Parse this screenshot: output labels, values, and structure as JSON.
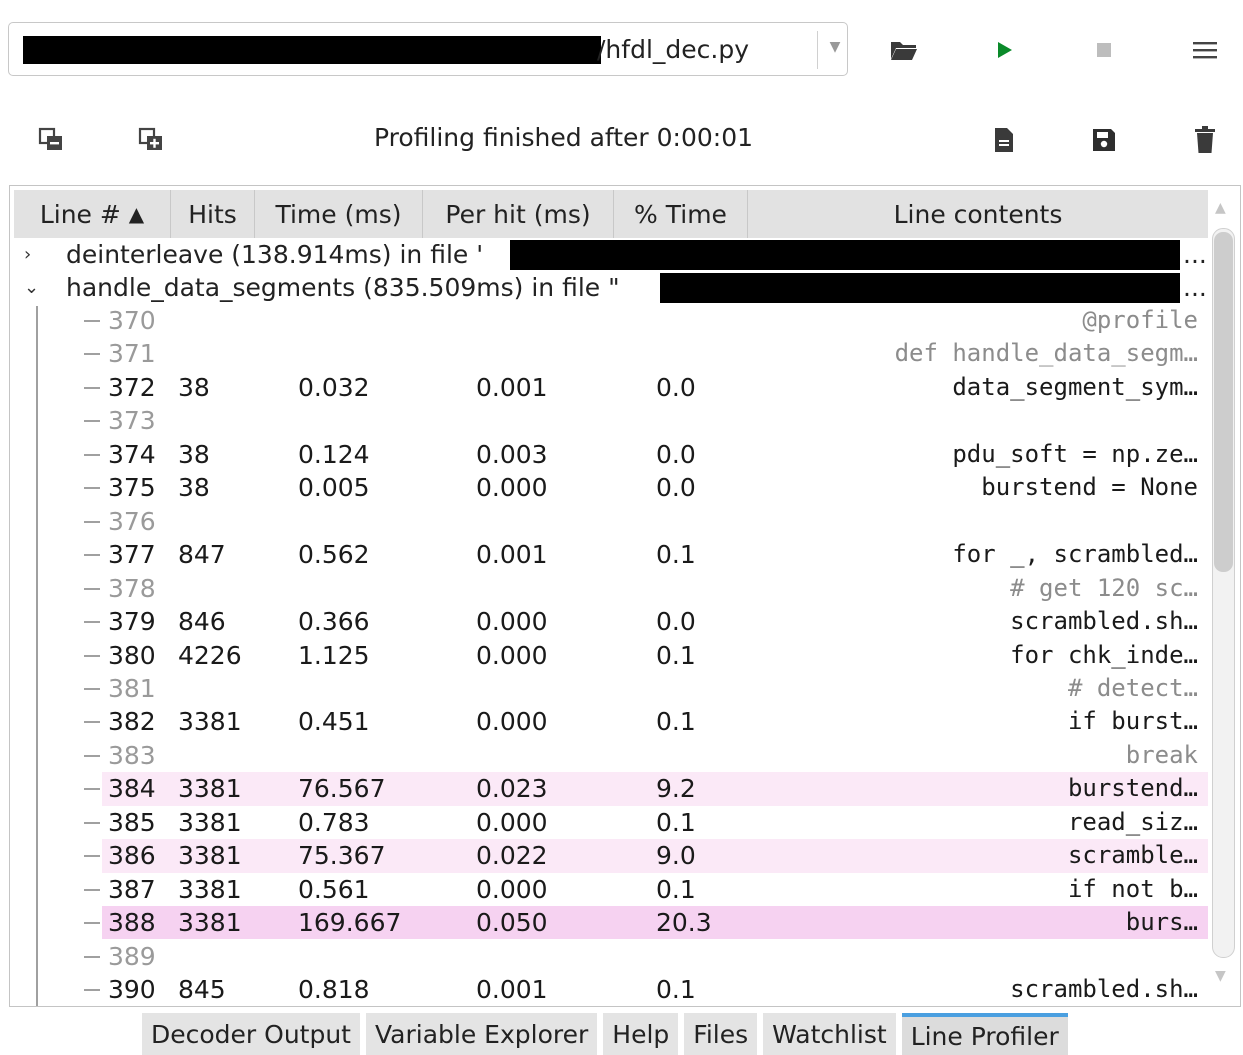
{
  "toolbar": {
    "file_path_visible": "/hfdl_dec.py",
    "icons": [
      "folder-open-icon",
      "play-icon",
      "stop-icon",
      "hamburger-menu-icon"
    ],
    "colors": {
      "play": "#0a8a2a",
      "stop_disabled": "#bdbdbd"
    }
  },
  "status": {
    "text": "Profiling finished after 0:00:01",
    "left_icons": [
      "collapse-all-icon",
      "expand-all-icon"
    ],
    "right_icons": [
      "file-icon",
      "save-icon",
      "trash-icon"
    ]
  },
  "table": {
    "columns": [
      {
        "label": "Line #",
        "sort": "asc"
      },
      {
        "label": "Hits"
      },
      {
        "label": "Time (ms)"
      },
      {
        "label": "Per hit (ms)"
      },
      {
        "label": "% Time"
      },
      {
        "label": "Line contents"
      }
    ],
    "sort_arrow": "▲",
    "functions": [
      {
        "chevron": "›",
        "label": "deinterleave (138.914ms) in file '",
        "suffix": "..."
      },
      {
        "chevron": "⌄",
        "label": "handle_data_segments (835.509ms) in file \"",
        "suffix": "..."
      }
    ],
    "rows": [
      {
        "line": "370",
        "hits": "",
        "time": "",
        "per": "",
        "pct": "",
        "code": "@profile",
        "muted": true
      },
      {
        "line": "371",
        "hits": "",
        "time": "",
        "per": "",
        "pct": "",
        "code": "def handle_data_segm…",
        "muted": true
      },
      {
        "line": "372",
        "hits": "38",
        "time": "0.032",
        "per": "0.001",
        "pct": "0.0",
        "code": "data_segment_sym…"
      },
      {
        "line": "373",
        "hits": "",
        "time": "",
        "per": "",
        "pct": "",
        "code": ""
      },
      {
        "line": "374",
        "hits": "38",
        "time": "0.124",
        "per": "0.003",
        "pct": "0.0",
        "code": "pdu_soft = np.ze…"
      },
      {
        "line": "375",
        "hits": "38",
        "time": "0.005",
        "per": "0.000",
        "pct": "0.0",
        "code": "burstend = None"
      },
      {
        "line": "376",
        "hits": "",
        "time": "",
        "per": "",
        "pct": "",
        "code": ""
      },
      {
        "line": "377",
        "hits": "847",
        "time": "0.562",
        "per": "0.001",
        "pct": "0.1",
        "code": "for _, scrambled…"
      },
      {
        "line": "378",
        "hits": "",
        "time": "",
        "per": "",
        "pct": "",
        "code": "# get 120 sc…",
        "muted": true
      },
      {
        "line": "379",
        "hits": "846",
        "time": "0.366",
        "per": "0.000",
        "pct": "0.0",
        "code": "scrambled.sh…"
      },
      {
        "line": "380",
        "hits": "4226",
        "time": "1.125",
        "per": "0.000",
        "pct": "0.1",
        "code": "for chk_inde…"
      },
      {
        "line": "381",
        "hits": "",
        "time": "",
        "per": "",
        "pct": "",
        "code": "# detect…",
        "muted": true
      },
      {
        "line": "382",
        "hits": "3381",
        "time": "0.451",
        "per": "0.000",
        "pct": "0.1",
        "code": "if burst…"
      },
      {
        "line": "383",
        "hits": "",
        "time": "",
        "per": "",
        "pct": "",
        "code": "break",
        "muted": true
      },
      {
        "line": "384",
        "hits": "3381",
        "time": "76.567",
        "per": "0.023",
        "pct": "9.2",
        "code": "burstend…",
        "hl": 1
      },
      {
        "line": "385",
        "hits": "3381",
        "time": "0.783",
        "per": "0.000",
        "pct": "0.1",
        "code": "read_siz…"
      },
      {
        "line": "386",
        "hits": "3381",
        "time": "75.367",
        "per": "0.022",
        "pct": "9.0",
        "code": "scramble…",
        "hl": 1
      },
      {
        "line": "387",
        "hits": "3381",
        "time": "0.561",
        "per": "0.000",
        "pct": "0.1",
        "code": "if not b…"
      },
      {
        "line": "388",
        "hits": "3381",
        "time": "169.667",
        "per": "0.050",
        "pct": "20.3",
        "code": "burs…",
        "hl": 2
      },
      {
        "line": "389",
        "hits": "",
        "time": "",
        "per": "",
        "pct": "",
        "code": ""
      },
      {
        "line": "390",
        "hits": "845",
        "time": "0.818",
        "per": "0.001",
        "pct": "0.1",
        "code": "scrambled.sh…"
      }
    ],
    "highlight_colors": {
      "light": "#fbe9f7",
      "strong": "#f6d2f1"
    }
  },
  "tabs": [
    {
      "label": "Decoder Output"
    },
    {
      "label": "Variable Explorer"
    },
    {
      "label": "Help"
    },
    {
      "label": "Files"
    },
    {
      "label": "Watchlist"
    },
    {
      "label": "Line Profiler",
      "active": true
    }
  ],
  "accent_color": "#4a9fe0"
}
